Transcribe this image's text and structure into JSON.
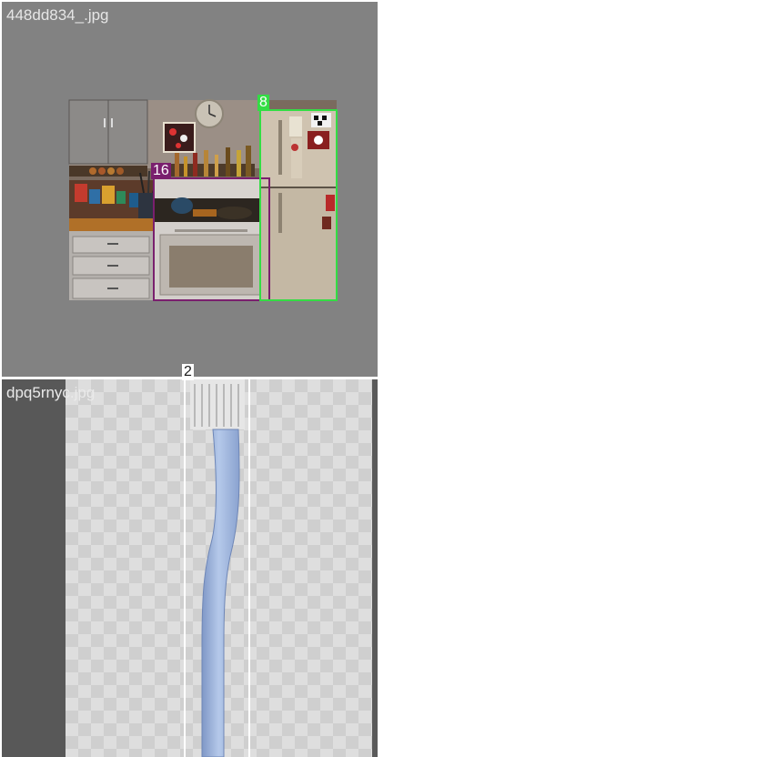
{
  "tiles": [
    {
      "filename": "448dd834_.jpg",
      "scene": "kitchen-photo",
      "boxes": [
        {
          "id": "8",
          "color": "#33dd44",
          "tag_text_color": "#ffffff"
        },
        {
          "id": "16",
          "color": "#7a1f6e",
          "tag_text_color": "#ffffff"
        }
      ]
    },
    {
      "filename": "dpq5rnyc.jpg",
      "scene": "toothbrush-on-transparent",
      "boxes": [
        {
          "id": "2",
          "color": "#ffffff",
          "tag_text_color": "#1a1a1a"
        }
      ]
    }
  ]
}
